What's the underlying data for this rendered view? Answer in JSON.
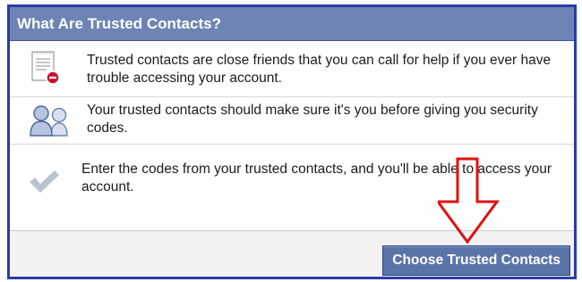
{
  "dialog": {
    "title": "What Are Trusted Contacts?"
  },
  "rows": [
    {
      "icon": "document-blocked-icon",
      "text": "Trusted contacts are close friends that you can call for help if you ever have trouble accessing your account."
    },
    {
      "icon": "people-icon",
      "text": "Your trusted contacts should make sure it's you before giving you security codes."
    },
    {
      "icon": "checkmark-icon",
      "text": "Enter the codes from your trusted contacts, and you'll be able to access your account."
    }
  ],
  "footer": {
    "button_label": "Choose Trusted Contacts"
  },
  "colors": {
    "header_bg": "#6d84b4",
    "button_bg": "#5b74a8",
    "border_blue": "#2b3ca8",
    "annotation_red": "#e01010"
  }
}
